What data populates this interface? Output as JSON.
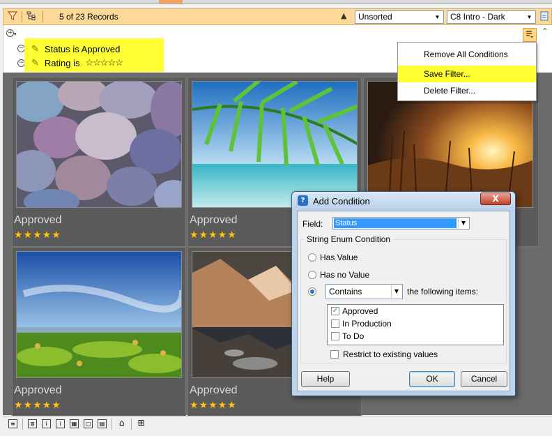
{
  "toolbar": {
    "record_count": "5 of 23 Records",
    "sort_value": "Unsorted",
    "theme_value": "C8 Intro - Dark"
  },
  "filter": {
    "conditions": [
      {
        "label": "Status is Approved"
      },
      {
        "label": "Rating is",
        "rating_stars": "☆☆☆☆☆"
      }
    ]
  },
  "menu": {
    "items": [
      "Remove All Conditions",
      "Save Filter...",
      "Delete Filter..."
    ],
    "highlighted_index": 1
  },
  "gallery": {
    "cards": [
      {
        "status": "Approved",
        "rating": "★★★★★",
        "image": "pebbles"
      },
      {
        "status": "Approved",
        "rating": "★★★★★",
        "image": "palm-beach"
      },
      {
        "status": "",
        "rating": "",
        "image": "sunset-grass"
      },
      {
        "status": "Approved",
        "rating": "★★★★★",
        "image": "coastal-meadow"
      },
      {
        "status": "Approved",
        "rating": "★★★★★",
        "image": "mountain-lake"
      }
    ]
  },
  "dialog": {
    "title": "Add Condition",
    "close_label": "X",
    "field_label": "Field:",
    "field_value": "Status",
    "group_title": "String Enum Condition",
    "options": {
      "has_value": "Has Value",
      "has_no_value": "Has no Value",
      "contains": "Contains",
      "following": "the following items:"
    },
    "selected_option": "contains",
    "items": [
      {
        "label": "Approved",
        "checked": true
      },
      {
        "label": "In Production",
        "checked": false
      },
      {
        "label": "To Do",
        "checked": false
      }
    ],
    "restrict_label": "Restrict to existing values",
    "restrict_checked": false,
    "help_label": "Help",
    "ok_label": "OK",
    "cancel_label": "Cancel"
  },
  "colors": {
    "toolbar_bg": "#fcd999",
    "highlight": "#ffff33",
    "gallery_bg": "#6a6a6a",
    "star": "#ffc21a"
  }
}
